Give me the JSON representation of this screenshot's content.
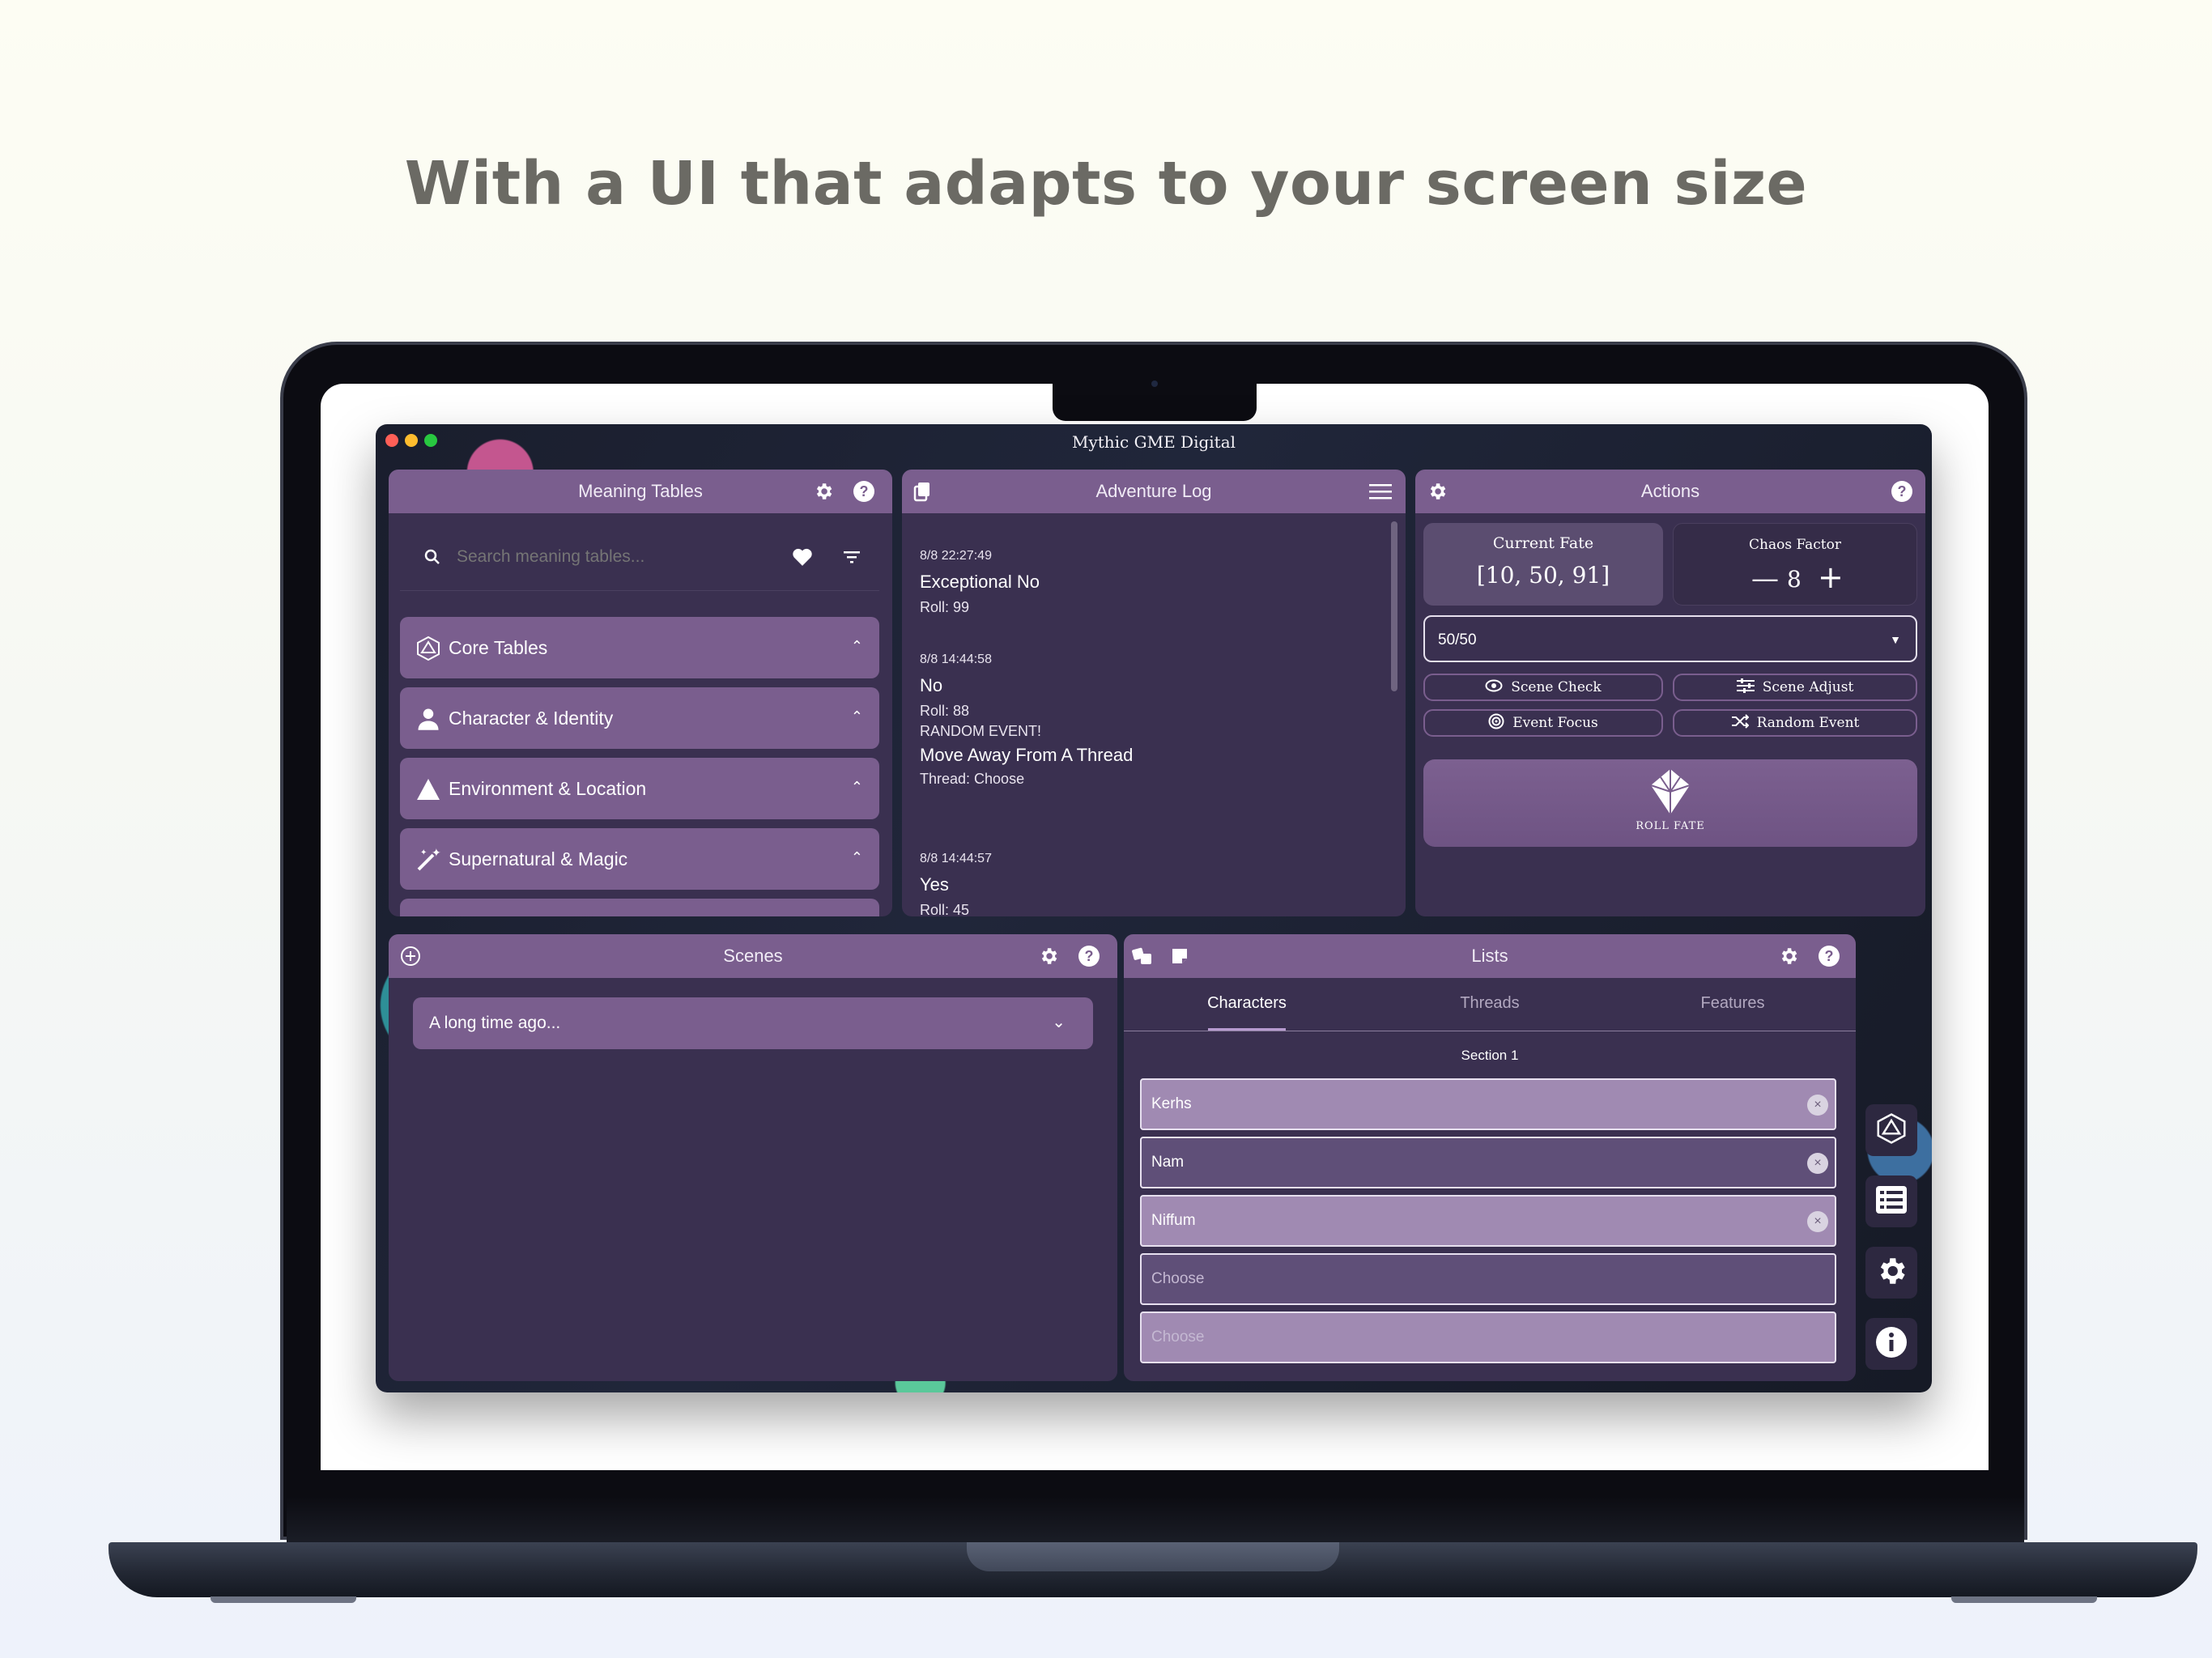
{
  "headline": "With a UI that adapts to your screen size",
  "app": {
    "title": "Mythic GME Digital"
  },
  "meaning_tables": {
    "title": "Meaning Tables",
    "search_placeholder": "Search meaning tables...",
    "items": [
      {
        "label": "Core Tables",
        "icon": "d20-icon"
      },
      {
        "label": "Character & Identity",
        "icon": "person-icon"
      },
      {
        "label": "Environment & Location",
        "icon": "mountain-icon"
      },
      {
        "label": "Supernatural & Magic",
        "icon": "magic-wand-icon"
      }
    ]
  },
  "adventure_log": {
    "title": "Adventure Log",
    "entries": [
      {
        "time": "8/8 22:27:49",
        "result": "Exceptional No",
        "roll": "Roll: 99"
      },
      {
        "time": "8/8 14:44:58",
        "result": "No",
        "roll": "Roll: 88",
        "event_tag": "RANDOM EVENT!",
        "event": "Move Away From A Thread",
        "thread": "Thread: Choose"
      },
      {
        "time": "8/8 14:44:57",
        "result": "Yes",
        "roll": "Roll: 45"
      }
    ]
  },
  "actions": {
    "title": "Actions",
    "current_fate_label": "Current Fate",
    "current_fate_value": "[10, 50, 91]",
    "chaos_factor_label": "Chaos Factor",
    "chaos_factor_value": "8",
    "odds_selected": "50/50",
    "buttons": {
      "scene_check": "Scene Check",
      "scene_adjust": "Scene Adjust",
      "event_focus": "Event Focus",
      "random_event": "Random Event",
      "roll_fate": "ROLL FATE"
    }
  },
  "scenes": {
    "title": "Scenes",
    "selected_scene": "A long time ago..."
  },
  "lists": {
    "title": "Lists",
    "tabs": [
      "Characters",
      "Threads",
      "Features"
    ],
    "active_tab": "Characters",
    "section": "Section 1",
    "rows": [
      "Kerhs",
      "Nam",
      "Niffum",
      "Choose",
      "Choose"
    ]
  },
  "colors": {
    "accent": "#7a5e8e",
    "panel_bg": "#3a3050"
  }
}
